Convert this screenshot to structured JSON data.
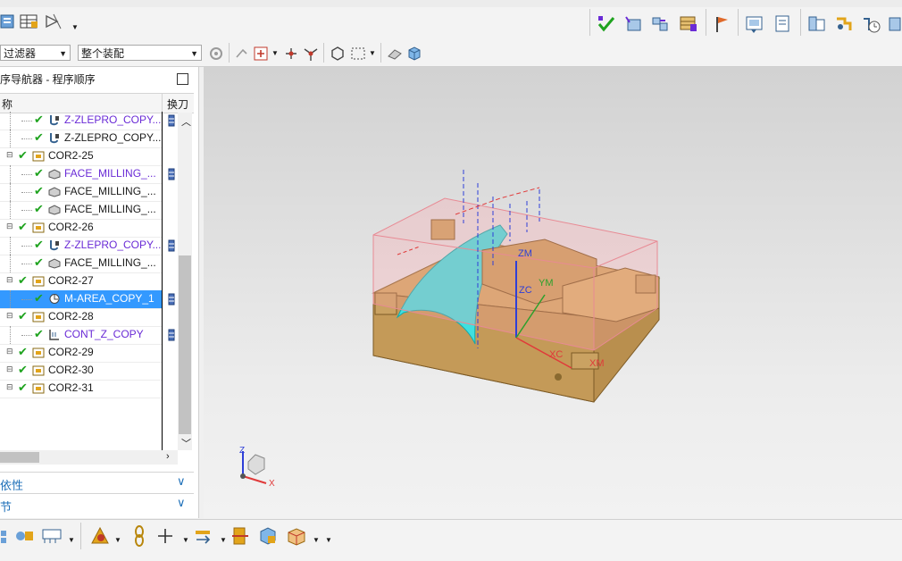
{
  "app": {
    "accent": "#3399ff",
    "check_color": "#1fa31f",
    "purple": "#6a2bd6"
  },
  "toolbar_top": {
    "left_icons": [
      "program-view-icon",
      "table-icon",
      "measure-icon"
    ],
    "right_icons": [
      "verify-icon",
      "generate-toolpath-icon",
      "replay-icon",
      "post-process-icon",
      "flag-icon",
      "shop-doc-icon",
      "output-icon",
      "list-icon",
      "config-icon",
      "clock-icon"
    ]
  },
  "selection_bar": {
    "filter_value": "过滤器",
    "assembly_value": "整个装配"
  },
  "navigator": {
    "title": "序导航器 - 程序顺序",
    "col_name": "称",
    "col_tool": "换刀",
    "rows": [
      {
        "label": "Z-ZLEPRO_COPY...",
        "purple": true,
        "level": 2,
        "type": "op",
        "tool": true
      },
      {
        "label": "Z-ZLEPRO_COPY...",
        "purple": false,
        "level": 2,
        "type": "op",
        "tool": false
      },
      {
        "label": "COR2-25",
        "purple": false,
        "level": 1,
        "type": "group",
        "tool": false
      },
      {
        "label": "FACE_MILLING_...",
        "purple": true,
        "level": 2,
        "type": "face",
        "tool": true
      },
      {
        "label": "FACE_MILLING_...",
        "purple": false,
        "level": 2,
        "type": "face",
        "tool": false
      },
      {
        "label": "FACE_MILLING_...",
        "purple": false,
        "level": 2,
        "type": "face",
        "tool": false
      },
      {
        "label": "COR2-26",
        "purple": false,
        "level": 1,
        "type": "group",
        "tool": false
      },
      {
        "label": "Z-ZLEPRO_COPY...",
        "purple": true,
        "level": 2,
        "type": "op",
        "tool": true
      },
      {
        "label": "FACE_MILLING_...",
        "purple": false,
        "level": 2,
        "type": "face",
        "tool": false
      },
      {
        "label": "COR2-27",
        "purple": false,
        "level": 1,
        "type": "group",
        "tool": false
      },
      {
        "label": "M-AREA_COPY_1",
        "purple": false,
        "level": 2,
        "type": "area",
        "tool": true,
        "selected": true
      },
      {
        "label": "COR2-28",
        "purple": false,
        "level": 1,
        "type": "group",
        "tool": false
      },
      {
        "label": "CONT_Z_COPY",
        "purple": true,
        "level": 2,
        "type": "cont",
        "tool": true
      },
      {
        "label": "COR2-29",
        "purple": false,
        "level": 1,
        "type": "group",
        "tool": false
      },
      {
        "label": "COR2-30",
        "purple": false,
        "level": 1,
        "type": "group",
        "tool": false
      },
      {
        "label": "COR2-31",
        "purple": false,
        "level": 1,
        "type": "group",
        "tool": false
      }
    ],
    "section1": "依性",
    "section2": "节"
  },
  "viewport": {
    "axis_labels": {
      "zm": "ZM",
      "ym": "YM",
      "zc": "ZC",
      "xc": "XC",
      "xm": "XM"
    },
    "triad": {
      "z": "Z",
      "x": "X"
    }
  }
}
